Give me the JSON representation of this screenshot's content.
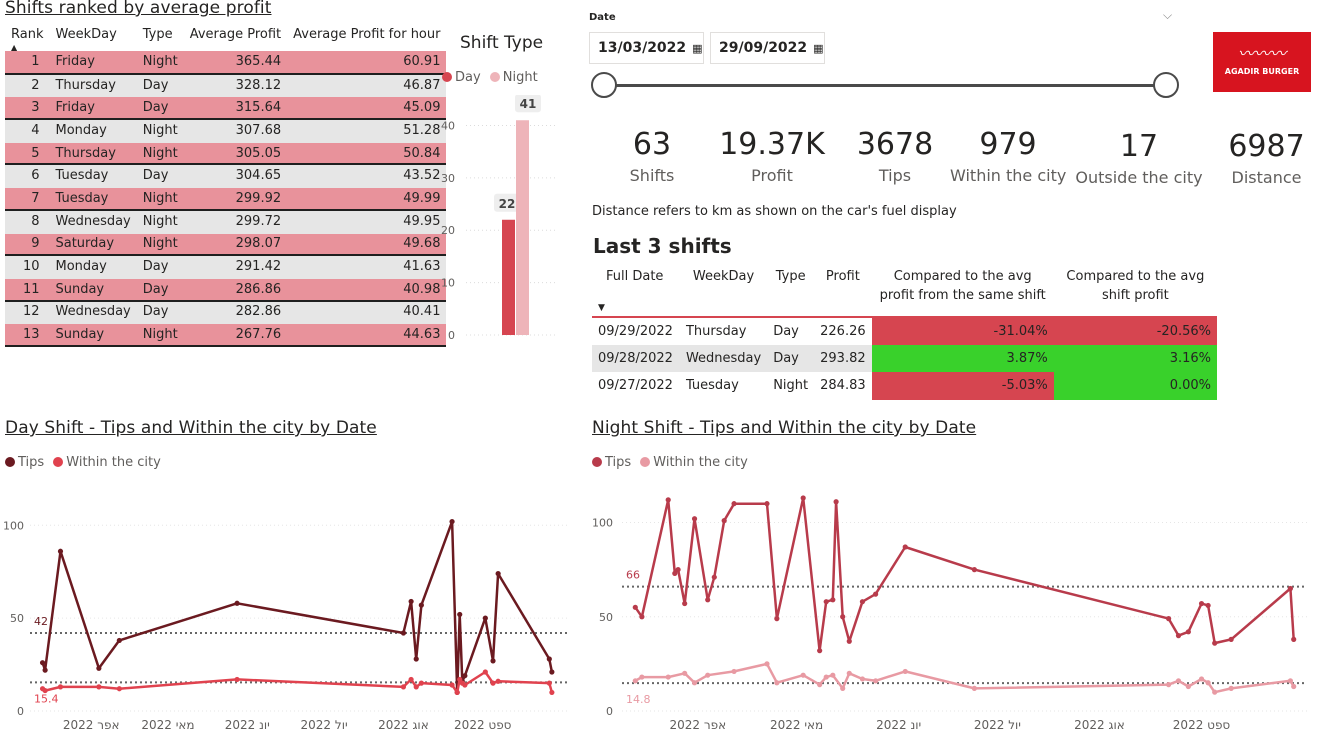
{
  "ranking": {
    "title": "Shifts ranked by average profit",
    "columns": [
      "Rank",
      "WeekDay",
      "Type",
      "Average Profit",
      "Average Profit for hour"
    ],
    "rows": [
      [
        "1",
        "Friday",
        "Night",
        "365.44",
        "60.91"
      ],
      [
        "2",
        "Thursday",
        "Day",
        "328.12",
        "46.87"
      ],
      [
        "3",
        "Friday",
        "Day",
        "315.64",
        "45.09"
      ],
      [
        "4",
        "Monday",
        "Night",
        "307.68",
        "51.28"
      ],
      [
        "5",
        "Thursday",
        "Night",
        "305.05",
        "50.84"
      ],
      [
        "6",
        "Tuesday",
        "Day",
        "304.65",
        "43.52"
      ],
      [
        "7",
        "Tuesday",
        "Night",
        "299.92",
        "49.99"
      ],
      [
        "8",
        "Wednesday",
        "Night",
        "299.72",
        "49.95"
      ],
      [
        "9",
        "Saturday",
        "Night",
        "298.07",
        "49.68"
      ],
      [
        "10",
        "Monday",
        "Day",
        "291.42",
        "41.63"
      ],
      [
        "11",
        "Sunday",
        "Day",
        "286.86",
        "40.98"
      ],
      [
        "12",
        "Wednesday",
        "Day",
        "282.86",
        "40.41"
      ],
      [
        "13",
        "Sunday",
        "Night",
        "267.76",
        "44.63"
      ]
    ]
  },
  "shift_type": {
    "title": "Shift Type",
    "legend": [
      "Day",
      "Night"
    ]
  },
  "date_filter": {
    "label": "Date",
    "start": "13/03/2022",
    "end": "29/09/2022"
  },
  "logo_text": "AGADIR BURGER",
  "kpis": [
    {
      "value": "63",
      "label": "Shifts"
    },
    {
      "value": "19.37K",
      "label": "Profit"
    },
    {
      "value": "3678",
      "label": "Tips"
    },
    {
      "value": "979",
      "label": "Within the city"
    },
    {
      "value": "17",
      "label": "Outside the city"
    },
    {
      "value": "6987",
      "label": "Distance"
    }
  ],
  "distance_note": "Distance refers to km as shown on the car's fuel display",
  "last_shifts": {
    "title": "Last 3 shifts",
    "columns": [
      "Full Date",
      "WeekDay",
      "Type",
      "Profit",
      "Compared to the avg profit from the same shift",
      "Compared to the avg shift profit"
    ],
    "rows": [
      {
        "date": "09/29/2022",
        "weekday": "Thursday",
        "type": "Day",
        "profit": "226.26",
        "cmp_same": "-31.04%",
        "cmp_avg": "-20.56%"
      },
      {
        "date": "09/28/2022",
        "weekday": "Wednesday",
        "type": "Day",
        "profit": "293.82",
        "cmp_same": "3.87%",
        "cmp_avg": "3.16%"
      },
      {
        "date": "09/27/2022",
        "weekday": "Tuesday",
        "type": "Night",
        "profit": "284.83",
        "cmp_same": "-5.03%",
        "cmp_avg": "0.00%"
      }
    ]
  },
  "colors": {
    "day": "#d64550",
    "night": "#eeb4b9",
    "day_tips": "#6b1a20",
    "day_within": "#e0424e",
    "night_tips": "#b83b4b",
    "night_within": "#e89aa3",
    "negative": "#d64550",
    "positive": "#39d12b",
    "logo_bg": "#d7141f"
  },
  "chart_data": [
    {
      "type": "bar",
      "title": "Shift Type",
      "categories": [
        ""
      ],
      "series": [
        {
          "name": "Day",
          "values": [
            22
          ]
        },
        {
          "name": "Night",
          "values": [
            41
          ]
        }
      ],
      "ylim": [
        0,
        42
      ],
      "yticks": [
        0,
        10,
        20,
        30,
        40
      ],
      "legend": "top-left",
      "grid": true
    },
    {
      "type": "line",
      "title": "Day Shift - Tips and Within the city by Date",
      "legend": "top-left",
      "ylim": [
        0,
        105
      ],
      "yticks": [
        0,
        50,
        100
      ],
      "xlim": [
        "2022-03-12",
        "2022-09-30"
      ],
      "xticks": [
        {
          "date": "2022-04-01",
          "label": "אפר 2022"
        },
        {
          "date": "2022-05-01",
          "label": "מאי 2022"
        },
        {
          "date": "2022-06-01",
          "label": "יונ 2022"
        },
        {
          "date": "2022-07-01",
          "label": "יול 2022"
        },
        {
          "date": "2022-08-01",
          "label": "אוג 2022"
        },
        {
          "date": "2022-09-01",
          "label": "ספט 2022"
        }
      ],
      "reference_lines": [
        {
          "value": 42,
          "label": "42",
          "series": "Tips"
        },
        {
          "value": 15.4,
          "label": "15.4",
          "series": "Within the city"
        }
      ],
      "series": [
        {
          "name": "Tips",
          "x": [
            "2022-03-13",
            "2022-03-14",
            "2022-03-20",
            "2022-04-04",
            "2022-04-12",
            "2022-05-28",
            "2022-08-01",
            "2022-08-04",
            "2022-08-06",
            "2022-08-08",
            "2022-08-20",
            "2022-08-22",
            "2022-08-23",
            "2022-08-24",
            "2022-08-25",
            "2022-09-02",
            "2022-09-05",
            "2022-09-07",
            "2022-09-27",
            "2022-09-28"
          ],
          "y": [
            26,
            22,
            86,
            23,
            38,
            58,
            42,
            59,
            28,
            57,
            102,
            10,
            52,
            16,
            19,
            50,
            27,
            74,
            28,
            21
          ]
        },
        {
          "name": "Within the city",
          "x": [
            "2022-03-13",
            "2022-03-14",
            "2022-03-20",
            "2022-04-04",
            "2022-04-12",
            "2022-05-28",
            "2022-08-01",
            "2022-08-04",
            "2022-08-06",
            "2022-08-08",
            "2022-08-20",
            "2022-08-22",
            "2022-08-23",
            "2022-08-24",
            "2022-08-25",
            "2022-09-02",
            "2022-09-05",
            "2022-09-07",
            "2022-09-27",
            "2022-09-28"
          ],
          "y": [
            12,
            11,
            13,
            13,
            12,
            17,
            13,
            17,
            13,
            15,
            14,
            10,
            17,
            15,
            14,
            21,
            15,
            16,
            15,
            10
          ]
        }
      ]
    },
    {
      "type": "line",
      "title": "Night Shift - Tips and Within the city by Date",
      "legend": "top-left",
      "ylim": [
        0,
        113
      ],
      "yticks": [
        0,
        50,
        100
      ],
      "xlim": [
        "2022-03-12",
        "2022-09-30"
      ],
      "xticks": [
        {
          "date": "2022-04-01",
          "label": "אפר 2022"
        },
        {
          "date": "2022-05-01",
          "label": "מאי 2022"
        },
        {
          "date": "2022-06-01",
          "label": "יונ 2022"
        },
        {
          "date": "2022-07-01",
          "label": "יול 2022"
        },
        {
          "date": "2022-08-01",
          "label": "אוג 2022"
        },
        {
          "date": "2022-09-01",
          "label": "ספט 2022"
        }
      ],
      "reference_lines": [
        {
          "value": 66,
          "label": "66",
          "series": "Tips"
        },
        {
          "value": 14.8,
          "label": "14.8",
          "series": "Within the city"
        }
      ],
      "series": [
        {
          "name": "Tips",
          "x": [
            "2022-03-13",
            "2022-03-15",
            "2022-03-23",
            "2022-03-25",
            "2022-03-26",
            "2022-03-28",
            "2022-03-31",
            "2022-04-04",
            "2022-04-06",
            "2022-04-09",
            "2022-04-12",
            "2022-04-22",
            "2022-04-25",
            "2022-05-03",
            "2022-05-08",
            "2022-05-10",
            "2022-05-12",
            "2022-05-13",
            "2022-05-15",
            "2022-05-17",
            "2022-05-21",
            "2022-05-25",
            "2022-06-03",
            "2022-06-24",
            "2022-08-22",
            "2022-08-25",
            "2022-08-28",
            "2022-09-01",
            "2022-09-03",
            "2022-09-05",
            "2022-09-10",
            "2022-09-28",
            "2022-09-29"
          ],
          "y": [
            55,
            50,
            112,
            73,
            75,
            57,
            102,
            59,
            71,
            101,
            110,
            110,
            49,
            113,
            32,
            58,
            59,
            111,
            50,
            37,
            58,
            62,
            87,
            75,
            49,
            40,
            42,
            57,
            56,
            36,
            38,
            65,
            38
          ]
        },
        {
          "name": "Within the city",
          "x": [
            "2022-03-13",
            "2022-03-15",
            "2022-03-23",
            "2022-03-28",
            "2022-03-31",
            "2022-04-04",
            "2022-04-12",
            "2022-04-22",
            "2022-04-25",
            "2022-05-03",
            "2022-05-08",
            "2022-05-10",
            "2022-05-12",
            "2022-05-15",
            "2022-05-17",
            "2022-05-21",
            "2022-05-25",
            "2022-06-03",
            "2022-06-24",
            "2022-08-22",
            "2022-08-25",
            "2022-08-28",
            "2022-09-01",
            "2022-09-03",
            "2022-09-05",
            "2022-09-10",
            "2022-09-28",
            "2022-09-29"
          ],
          "y": [
            16,
            18,
            18,
            20,
            15,
            19,
            21,
            25,
            15,
            19,
            14,
            18,
            19,
            12,
            20,
            17,
            16,
            21,
            12,
            14,
            16,
            13,
            17,
            15,
            10,
            12,
            16,
            13
          ]
        }
      ]
    }
  ]
}
